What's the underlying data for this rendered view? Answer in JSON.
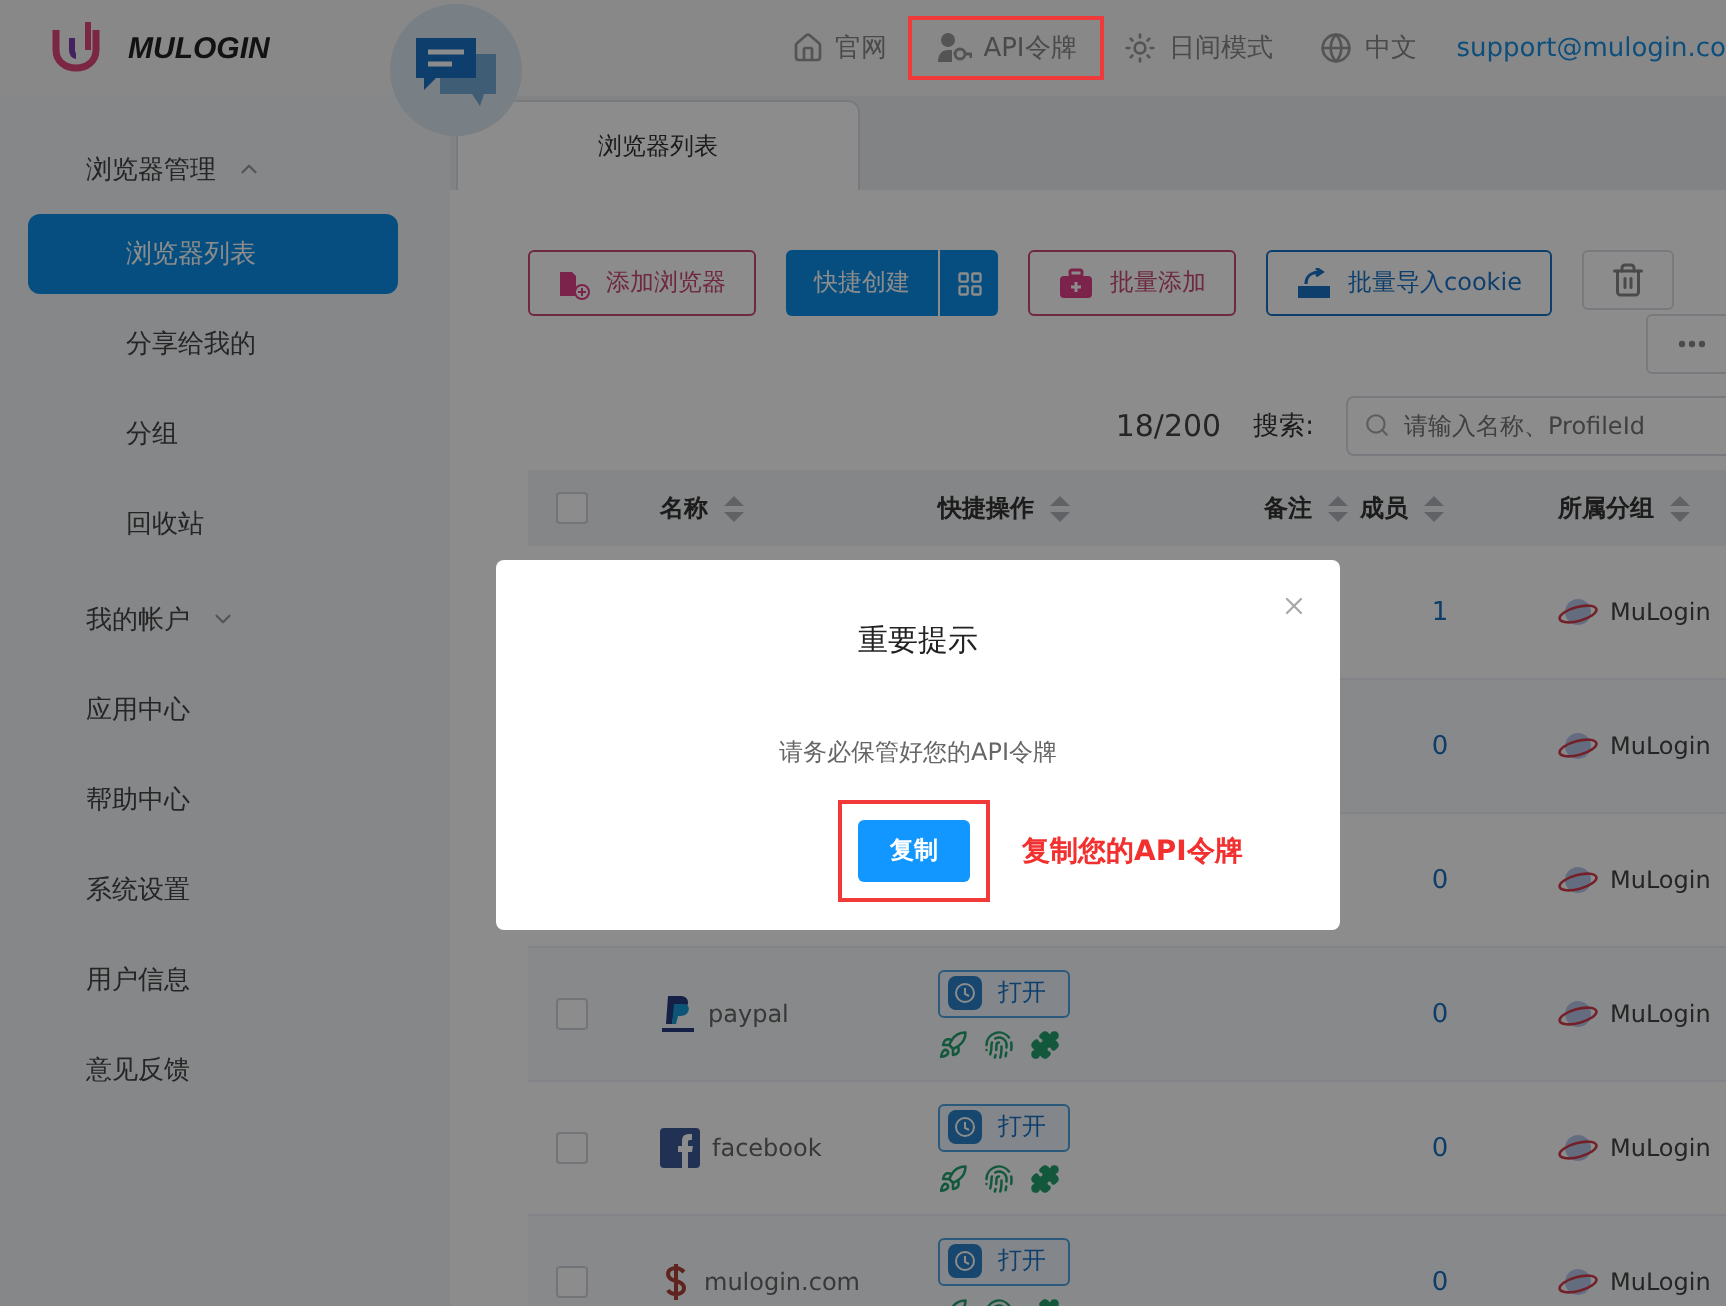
{
  "header": {
    "logo": "MULOGIN",
    "nav": [
      {
        "kind": "home",
        "label": "官网",
        "highlighted": false
      },
      {
        "kind": "key",
        "label": "API令牌",
        "highlighted": true
      },
      {
        "kind": "sun",
        "label": "日间模式",
        "highlighted": false
      },
      {
        "kind": "globe",
        "label": "中文",
        "highlighted": false
      }
    ],
    "email": "support@mulogin.co"
  },
  "sidebar": {
    "items": [
      {
        "label": "浏览器管理",
        "expanded": true,
        "children": [
          {
            "label": "浏览器列表",
            "selected": true
          },
          {
            "label": "分享给我的",
            "selected": false
          },
          {
            "label": "分组",
            "selected": false
          },
          {
            "label": "回收站",
            "selected": false
          }
        ]
      },
      {
        "label": "我的帐户",
        "expanded": false
      },
      {
        "label": "应用中心"
      },
      {
        "label": "帮助中心"
      },
      {
        "label": "系统设置"
      },
      {
        "label": "用户信息"
      },
      {
        "label": "意见反馈"
      }
    ]
  },
  "tabs": [
    {
      "label": "浏览器列表",
      "selected": true
    }
  ],
  "toolbar": [
    {
      "kind": "pink",
      "label": "添加浏览器"
    },
    {
      "kind": "split",
      "label": "快捷创建"
    },
    {
      "kind": "pink",
      "label": "批量添加"
    },
    {
      "kind": "blue",
      "label": "批量导入cookie"
    },
    {
      "kind": "trash"
    }
  ],
  "count": "18/200",
  "search": {
    "label": "搜索:",
    "placeholder": "请输入名称、ProfileId"
  },
  "table": {
    "select_all_checked": false,
    "columns": [
      "名称",
      "快捷操作",
      "备注",
      "成员",
      "所属分组"
    ],
    "rows": [
      {
        "members": "1",
        "group": "MuLogin"
      },
      {
        "members": "0",
        "group": "MuLogin"
      },
      {
        "members": "0",
        "group": "MuLogin"
      },
      {
        "checked": false,
        "name": "paypal",
        "open": "打开",
        "members": "0",
        "group": "MuLogin"
      },
      {
        "checked": false,
        "name": "facebook",
        "open": "打开",
        "members": "0",
        "group": "MuLogin"
      },
      {
        "checked": false,
        "name": "mulogin.com",
        "open": "打开",
        "members": "0",
        "group": "MuLogin"
      }
    ]
  },
  "dialog": {
    "title": "重要提示",
    "message": "请务必保管好您的API令牌",
    "button": "复制",
    "annotation": "复制您的API令牌"
  }
}
